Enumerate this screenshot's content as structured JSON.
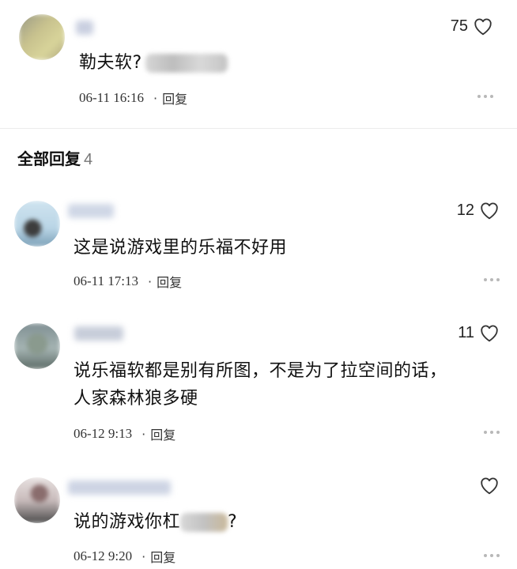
{
  "main_comment": {
    "likes": "75",
    "text": "勒夫软?",
    "time": "06-11 16:16",
    "reply_label": "回复"
  },
  "replies_section": {
    "title": "全部回复",
    "count": "4"
  },
  "replies": [
    {
      "likes": "12",
      "text": "这是说游戏里的乐福不好用",
      "time": "06-11 17:13",
      "reply_label": "回复"
    },
    {
      "likes": "11",
      "text_line1": "说乐福软都是别有所图，不是为了拉空间的话，",
      "text_line2": "人家森林狼多硬",
      "time": "06-12 9:13",
      "reply_label": "回复"
    },
    {
      "likes": "",
      "text_before": "说的游戏你杠",
      "text_after": "?",
      "time": "06-12 9:20",
      "reply_label": "回复"
    }
  ],
  "icons": {
    "like": "heart-outline-icon",
    "more": "more-dots-icon"
  },
  "colors": {
    "text": "#111111",
    "meta": "#444444",
    "divider": "#ececec",
    "more_dots": "#b8b8b8"
  }
}
